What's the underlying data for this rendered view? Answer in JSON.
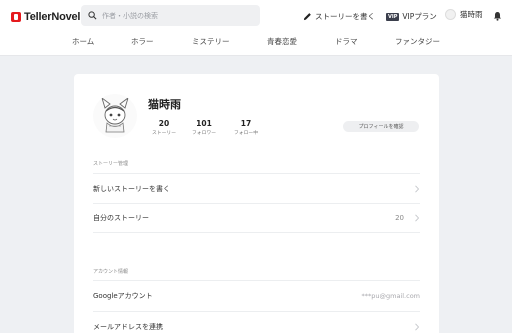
{
  "header": {
    "brand": "TellerNovel",
    "search_placeholder": "作者・小説の検索",
    "write_label": "ストーリーを書く",
    "vip_badge": "VIP",
    "vip_label": "VIPプラン",
    "username": "猫時雨"
  },
  "nav": {
    "items": [
      "ホーム",
      "ホラー",
      "ミステリー",
      "青春恋愛",
      "ドラマ",
      "ファンタジー"
    ]
  },
  "profile": {
    "name": "猫時雨",
    "stats": [
      {
        "value": "20",
        "label": "ストーリー"
      },
      {
        "value": "101",
        "label": "フォロワー"
      },
      {
        "value": "17",
        "label": "フォロー中"
      }
    ],
    "confirm_button": "プロフィールを確認"
  },
  "story_section": {
    "title": "ストーリー管理",
    "rows": [
      {
        "label": "新しいストーリーを書く",
        "value": ""
      },
      {
        "label": "自分のストーリー",
        "value": "20"
      }
    ]
  },
  "account_section": {
    "title": "アカウント情報",
    "rows": [
      {
        "label": "Googleアカウント",
        "value": "***pu@gmail.com"
      },
      {
        "label": "メールアドレスを連携",
        "value": ""
      }
    ]
  },
  "colors": {
    "brand_red": "#e51a1e",
    "background": "#eef0f3",
    "card": "#ffffff"
  }
}
